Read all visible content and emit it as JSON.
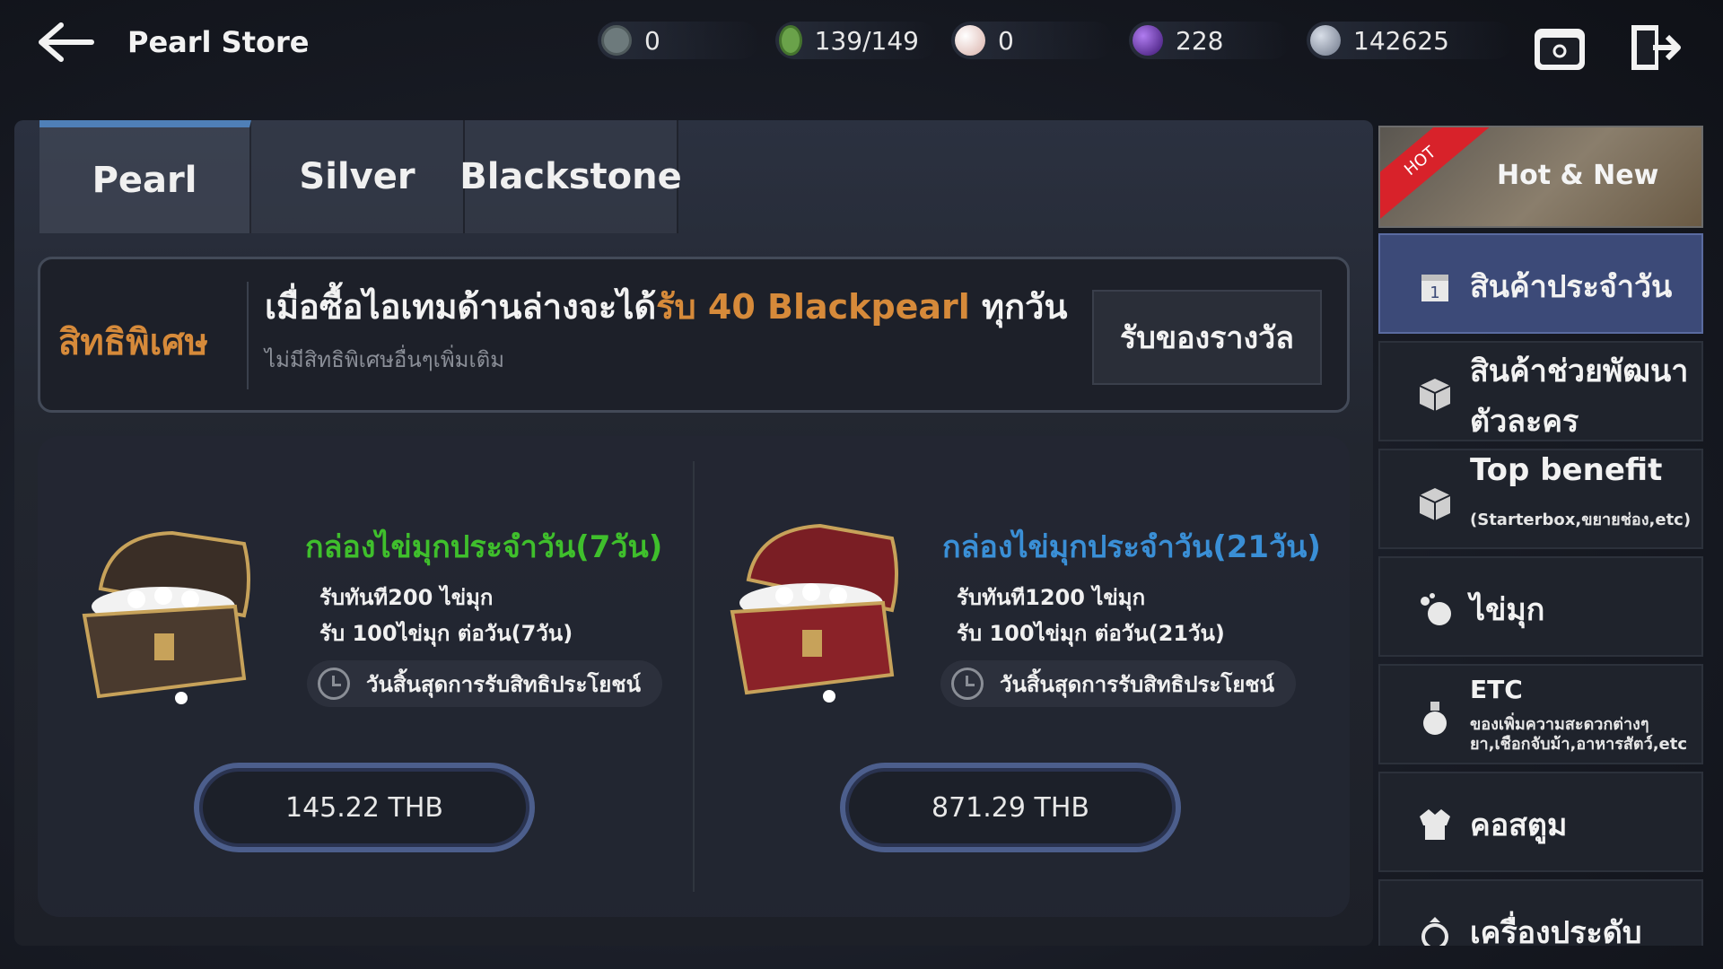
{
  "header": {
    "title": "Pearl Store",
    "currencies": [
      {
        "icon": "black-stone-icon",
        "value": "0",
        "color": "#6d7a7c"
      },
      {
        "icon": "energy-icon",
        "value": "139/149",
        "color": "#6aa24a"
      },
      {
        "icon": "pearl-icon",
        "value": "0",
        "color": "#e8c6c0"
      },
      {
        "icon": "black-pearl-icon",
        "value": "228",
        "color": "#6a2fb0"
      },
      {
        "icon": "silver-coin-icon",
        "value": "142625",
        "color": "#8c96a8"
      }
    ]
  },
  "tabs": [
    {
      "label": "Pearl",
      "active": true
    },
    {
      "label": "Silver",
      "active": false
    },
    {
      "label": "Blackstone",
      "active": false
    }
  ],
  "benefit": {
    "label": "สิทธิพิเศษ",
    "main_prefix": "เมื่อซื้อไอเทมด้านล่างจะได้",
    "main_highlight": "รับ 40 Blackpearl",
    "main_suffix": " ทุกวัน",
    "sub": "ไม่มีสิทธิพิเศษอื่นๆเพิ่มเติม",
    "claim_button": "รับของรางวัล"
  },
  "products": [
    {
      "title": "กล่องไข่มุกประจำวัน(7วัน)",
      "title_color": "#3fbf2c",
      "line1": "รับทันที200 ไข่มุก",
      "line2": "รับ 100ไข่มุก ต่อวัน(7วัน)",
      "end_label": "วันสิ้นสุดการรับสิทธิประโยชน์",
      "price": "145.22 THB",
      "chest_color": "#4a3a2e"
    },
    {
      "title": "กล่องไข่มุกประจำวัน(21วัน)",
      "title_color": "#3a8fd6",
      "line1": "รับทันที1200 ไข่มุก",
      "line2": "รับ 100ไข่มุก ต่อวัน(21วัน)",
      "end_label": "วันสิ้นสุดการรับสิทธิประโยชน์",
      "price": "871.29 THB",
      "chest_color": "#7a1e24"
    }
  ],
  "sidebar": {
    "hot_ribbon": "HOT",
    "hot_label": "Hot & New",
    "items": [
      {
        "label": "สินค้าประจำวัน",
        "sub": "",
        "icon": "daily-calendar-icon",
        "active": true
      },
      {
        "label": "สินค้าช่วยพัฒนา",
        "label2": "ตัวละคร",
        "sub": "",
        "icon": "box-icon",
        "active": false
      },
      {
        "label": "Top benefit",
        "sub": "(Starterbox,ขยายช่อง,etc)",
        "icon": "gift-box-icon",
        "active": false
      },
      {
        "label": "ไข่มุก",
        "sub": "",
        "icon": "pearls-icon",
        "active": false
      },
      {
        "label": "ETC",
        "sub": "ของเพิ่มความสะดวกต่างๆ",
        "sub2": "ยา,เชือกจับม้า,อาหารสัตว์,etc",
        "icon": "potion-icon",
        "active": false
      },
      {
        "label": "คอสตูม",
        "sub": "",
        "icon": "costume-icon",
        "active": false
      },
      {
        "label": "เครื่องประดับ",
        "sub": "",
        "icon": "ring-icon",
        "active": false
      }
    ]
  }
}
